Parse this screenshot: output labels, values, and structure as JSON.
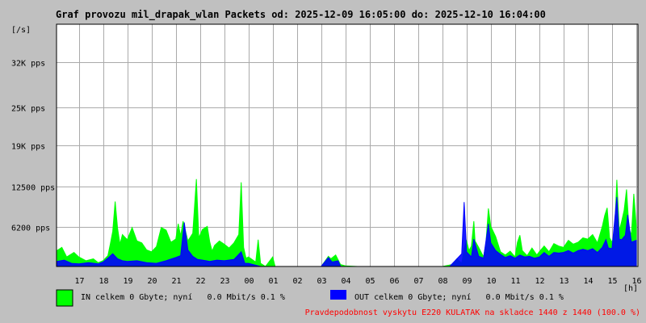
{
  "chart_data": {
    "type": "area",
    "title": "Graf provozu mil_drapak_wlan Packets od: 2025-12-09 16:05:00 do: 2025-12-10 16:04:00",
    "ylabel": "[/s]",
    "xlabel": "[h]",
    "ylim": [
      0,
      38000
    ],
    "y_ticks": [
      {
        "value": 6200,
        "label": "6200 pps"
      },
      {
        "value": 12500,
        "label": "12500 pps"
      },
      {
        "value": 19000,
        "label": "19K pps"
      },
      {
        "value": 25000,
        "label": "25K pps"
      },
      {
        "value": 32000,
        "label": "32K pps"
      }
    ],
    "x_range": [
      16.08,
      16.07
    ],
    "x_ticks": [
      "17",
      "18",
      "19",
      "20",
      "21",
      "22",
      "23",
      "00",
      "01",
      "02",
      "03",
      "04",
      "05",
      "06",
      "07",
      "08",
      "09",
      "10",
      "11",
      "12",
      "13",
      "14",
      "15",
      "16"
    ],
    "grid": true,
    "series": [
      {
        "name": "IN",
        "color": "#00ff00",
        "points": [
          [
            16.1,
            2500
          ],
          [
            16.3,
            3000
          ],
          [
            16.5,
            1500
          ],
          [
            16.8,
            2200
          ],
          [
            17.0,
            1500
          ],
          [
            17.3,
            900
          ],
          [
            17.6,
            1200
          ],
          [
            17.8,
            600
          ],
          [
            18.0,
            900
          ],
          [
            18.2,
            1700
          ],
          [
            18.3,
            3500
          ],
          [
            18.4,
            5500
          ],
          [
            18.5,
            10200
          ],
          [
            18.6,
            6000
          ],
          [
            18.7,
            3500
          ],
          [
            18.8,
            5000
          ],
          [
            19.0,
            4200
          ],
          [
            19.2,
            6100
          ],
          [
            19.4,
            4000
          ],
          [
            19.6,
            3700
          ],
          [
            19.8,
            2600
          ],
          [
            20.0,
            2300
          ],
          [
            20.2,
            3100
          ],
          [
            20.4,
            6100
          ],
          [
            20.6,
            5700
          ],
          [
            20.8,
            3800
          ],
          [
            21.0,
            4300
          ],
          [
            21.1,
            6700
          ],
          [
            21.2,
            4800
          ],
          [
            21.3,
            7100
          ],
          [
            21.5,
            4000
          ],
          [
            21.7,
            5200
          ],
          [
            21.85,
            13700
          ],
          [
            21.95,
            4500
          ],
          [
            22.1,
            5800
          ],
          [
            22.3,
            6300
          ],
          [
            22.4,
            3900
          ],
          [
            22.5,
            2400
          ],
          [
            22.6,
            3300
          ],
          [
            22.8,
            4000
          ],
          [
            23.0,
            3500
          ],
          [
            23.2,
            2900
          ],
          [
            23.4,
            3700
          ],
          [
            23.6,
            5000
          ],
          [
            23.7,
            13200
          ],
          [
            23.8,
            3000
          ],
          [
            23.9,
            1300
          ],
          [
            24.0,
            1500
          ],
          [
            24.3,
            700
          ],
          [
            24.4,
            4200
          ],
          [
            24.5,
            500
          ],
          [
            24.7,
            0
          ],
          [
            25.0,
            1500
          ],
          [
            25.1,
            0
          ],
          [
            26.0,
            0
          ],
          [
            26.8,
            0
          ],
          [
            27.0,
            0
          ],
          [
            27.3,
            1600
          ],
          [
            27.4,
            1200
          ],
          [
            27.6,
            1800
          ],
          [
            27.8,
            300
          ],
          [
            28.0,
            100
          ],
          [
            28.5,
            0
          ],
          [
            29.0,
            0
          ],
          [
            29.5,
            0
          ],
          [
            30.0,
            0
          ],
          [
            30.5,
            0
          ],
          [
            31.0,
            0
          ],
          [
            31.5,
            0
          ],
          [
            32.0,
            0
          ],
          [
            32.4,
            300
          ],
          [
            32.6,
            1200
          ],
          [
            32.8,
            500
          ],
          [
            32.9,
            2800
          ],
          [
            33.0,
            4000
          ],
          [
            33.1,
            2500
          ],
          [
            33.2,
            3200
          ],
          [
            33.3,
            7100
          ],
          [
            33.35,
            4000
          ],
          [
            33.5,
            3000
          ],
          [
            33.7,
            1500
          ],
          [
            33.8,
            3700
          ],
          [
            33.9,
            9100
          ],
          [
            34.0,
            6300
          ],
          [
            34.2,
            4700
          ],
          [
            34.4,
            2300
          ],
          [
            34.6,
            1800
          ],
          [
            34.8,
            2400
          ],
          [
            35.0,
            1500
          ],
          [
            35.1,
            3800
          ],
          [
            35.2,
            4900
          ],
          [
            35.3,
            2500
          ],
          [
            35.5,
            1700
          ],
          [
            35.7,
            2900
          ],
          [
            35.9,
            1800
          ],
          [
            36.0,
            2300
          ],
          [
            36.2,
            3200
          ],
          [
            36.4,
            2300
          ],
          [
            36.6,
            3600
          ],
          [
            36.8,
            3200
          ],
          [
            37.0,
            3000
          ],
          [
            37.2,
            4100
          ],
          [
            37.4,
            3500
          ],
          [
            37.6,
            3800
          ],
          [
            37.8,
            4500
          ],
          [
            38.0,
            4300
          ],
          [
            38.2,
            5000
          ],
          [
            38.4,
            3700
          ],
          [
            38.6,
            6300
          ],
          [
            38.7,
            8000
          ],
          [
            38.8,
            9200
          ],
          [
            38.9,
            4500
          ],
          [
            39.0,
            3800
          ],
          [
            39.1,
            5100
          ],
          [
            39.2,
            13600
          ],
          [
            39.3,
            5600
          ],
          [
            39.4,
            7100
          ],
          [
            39.5,
            8800
          ],
          [
            39.6,
            12100
          ],
          [
            39.7,
            6000
          ],
          [
            39.8,
            4900
          ],
          [
            39.9,
            11400
          ],
          [
            40.0,
            6400
          ]
        ]
      },
      {
        "name": "OUT",
        "color": "#0000ff",
        "points": [
          [
            16.1,
            800
          ],
          [
            16.4,
            1000
          ],
          [
            16.7,
            500
          ],
          [
            17.0,
            400
          ],
          [
            17.4,
            600
          ],
          [
            17.8,
            400
          ],
          [
            18.0,
            700
          ],
          [
            18.2,
            1300
          ],
          [
            18.4,
            2000
          ],
          [
            18.6,
            1200
          ],
          [
            18.8,
            900
          ],
          [
            19.0,
            800
          ],
          [
            19.4,
            900
          ],
          [
            19.8,
            600
          ],
          [
            20.2,
            500
          ],
          [
            20.6,
            900
          ],
          [
            21.0,
            1400
          ],
          [
            21.2,
            1700
          ],
          [
            21.35,
            6900
          ],
          [
            21.5,
            2600
          ],
          [
            21.7,
            1600
          ],
          [
            21.9,
            1100
          ],
          [
            22.1,
            1000
          ],
          [
            22.4,
            800
          ],
          [
            22.7,
            1000
          ],
          [
            23.0,
            900
          ],
          [
            23.4,
            1100
          ],
          [
            23.7,
            2300
          ],
          [
            23.85,
            500
          ],
          [
            24.0,
            500
          ],
          [
            24.5,
            0
          ],
          [
            26.0,
            0
          ],
          [
            27.0,
            0
          ],
          [
            27.3,
            1400
          ],
          [
            27.45,
            700
          ],
          [
            27.7,
            900
          ],
          [
            27.8,
            0
          ],
          [
            29.0,
            0
          ],
          [
            31.0,
            0
          ],
          [
            32.3,
            0
          ],
          [
            32.5,
            800
          ],
          [
            32.8,
            2000
          ],
          [
            32.9,
            10100
          ],
          [
            33.0,
            2300
          ],
          [
            33.2,
            1500
          ],
          [
            33.3,
            4300
          ],
          [
            33.5,
            1600
          ],
          [
            33.7,
            1300
          ],
          [
            33.9,
            6700
          ],
          [
            34.0,
            3700
          ],
          [
            34.2,
            2500
          ],
          [
            34.4,
            1900
          ],
          [
            34.6,
            1400
          ],
          [
            34.8,
            1700
          ],
          [
            35.0,
            1300
          ],
          [
            35.2,
            1800
          ],
          [
            35.4,
            1500
          ],
          [
            35.6,
            1600
          ],
          [
            35.8,
            1300
          ],
          [
            36.0,
            1500
          ],
          [
            36.2,
            2200
          ],
          [
            36.4,
            1600
          ],
          [
            36.6,
            2200
          ],
          [
            36.8,
            2100
          ],
          [
            37.0,
            2200
          ],
          [
            37.2,
            2500
          ],
          [
            37.4,
            2100
          ],
          [
            37.6,
            2500
          ],
          [
            37.8,
            2700
          ],
          [
            38.0,
            2500
          ],
          [
            38.2,
            2800
          ],
          [
            38.4,
            2200
          ],
          [
            38.6,
            3000
          ],
          [
            38.75,
            4200
          ],
          [
            38.85,
            2900
          ],
          [
            39.0,
            2800
          ],
          [
            39.2,
            10900
          ],
          [
            39.3,
            4300
          ],
          [
            39.4,
            4200
          ],
          [
            39.55,
            4900
          ],
          [
            39.65,
            8100
          ],
          [
            39.8,
            3800
          ],
          [
            40.0,
            4100
          ]
        ]
      }
    ]
  },
  "legend": {
    "in_label": "IN celkem 0 Gbyte; nyní   0.0 Mbit/s 0.1 %",
    "out_label": "OUT celkem 0 Gbyte; nyní   0.0 Mbit/s 0.1 %"
  },
  "footer": {
    "text": "Pravdepodobnost vyskytu E220 KULATAK na skladce 1440 z 1440 (100.0 %)",
    "color": "#ff0000"
  }
}
